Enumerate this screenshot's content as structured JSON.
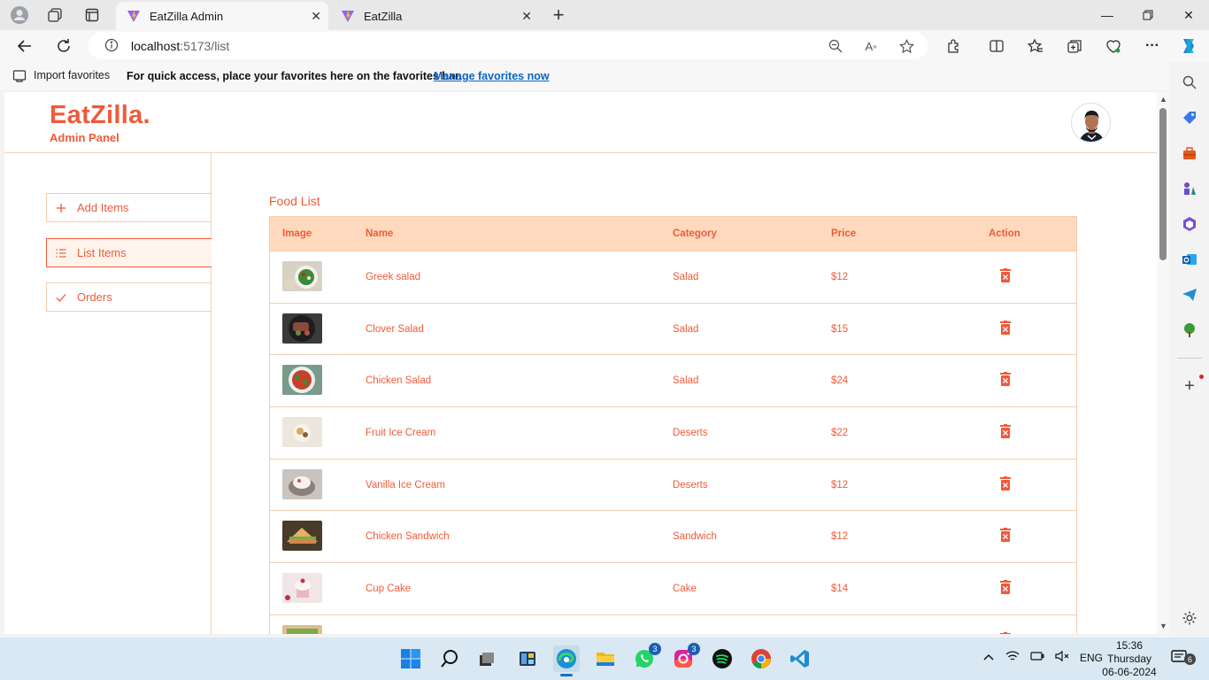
{
  "browser": {
    "tabs": [
      {
        "title": "EatZilla Admin",
        "active": true
      },
      {
        "title": "EatZilla",
        "active": false
      }
    ],
    "url_host": "localhost",
    "url_path": ":5173/list",
    "favorites_bar": {
      "import_label": "Import favorites",
      "quick_access_text": "For quick access, place your favorites here on the favorites bar.",
      "manage_link": "Manage favorites now"
    }
  },
  "app": {
    "logo": "EatZilla.",
    "subtitle": "Admin Panel",
    "accent_color": "#f05a3a",
    "header_bg": "#ffd9bd"
  },
  "sidebar": {
    "items": [
      {
        "label": "Add Items",
        "icon": "plus-icon",
        "active": false
      },
      {
        "label": "List Items",
        "icon": "list-icon",
        "active": true
      },
      {
        "label": "Orders",
        "icon": "check-icon",
        "active": false
      }
    ]
  },
  "main": {
    "title": "Food List",
    "columns": [
      "Image",
      "Name",
      "Category",
      "Price",
      "Action"
    ],
    "rows": [
      {
        "name": "Greek salad",
        "category": "Salad",
        "price": "$12"
      },
      {
        "name": "Clover Salad",
        "category": "Salad",
        "price": "$15"
      },
      {
        "name": "Chicken Salad",
        "category": "Salad",
        "price": "$24"
      },
      {
        "name": "Fruit Ice Cream",
        "category": "Deserts",
        "price": "$22"
      },
      {
        "name": "Vanilla Ice Cream",
        "category": "Deserts",
        "price": "$12"
      },
      {
        "name": "Chicken Sandwich",
        "category": "Sandwich",
        "price": "$12"
      },
      {
        "name": "Cup Cake",
        "category": "Cake",
        "price": "$14"
      }
    ]
  },
  "taskbar": {
    "whatsapp_badge": "3",
    "instagram_badge": "3",
    "language": "ENG",
    "notification_badge": "6",
    "time": "15:36",
    "day": "Thursday",
    "date": "06-06-2024"
  }
}
